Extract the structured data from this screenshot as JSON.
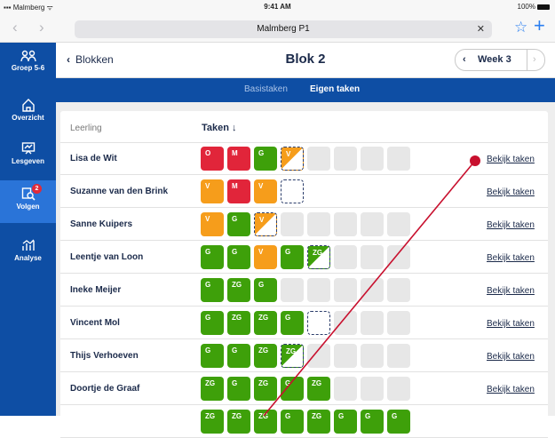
{
  "status": {
    "carrier": "Malmberg",
    "time": "9:41 AM",
    "battery": "100%"
  },
  "browser": {
    "url_title": "Malmberg P1",
    "back_icon": "chevron-left-icon",
    "forward_icon": "chevron-right-icon",
    "clear_icon": "close-icon",
    "bookmark_icon": "star-icon",
    "new_tab_icon": "plus-icon"
  },
  "sidebar": {
    "items": [
      {
        "label": "Groep 5-6",
        "icon": "group-icon"
      },
      {
        "label": "Overzicht",
        "icon": "home-icon"
      },
      {
        "label": "Lesgeven",
        "icon": "presentation-icon"
      },
      {
        "label": "Volgen",
        "icon": "search-list-icon",
        "badge": "2"
      },
      {
        "label": "Analyse",
        "icon": "chart-icon"
      }
    ]
  },
  "topbar": {
    "back_label": "Blokken",
    "title": "Blok 2",
    "week_label": "Week 3"
  },
  "tabs": {
    "basis": "Basistaken",
    "eigen": "Eigen taken"
  },
  "table": {
    "col_student": "Leerling",
    "col_tasks": "Taken",
    "link_label": "Bekijk taken",
    "rows": [
      {
        "name": "Lisa de Wit",
        "tiles": [
          [
            "red",
            "O"
          ],
          [
            "red",
            "M"
          ],
          [
            "grn",
            "G"
          ],
          [
            "half-o",
            "V"
          ],
          [
            "empty",
            ""
          ],
          [
            "empty",
            ""
          ],
          [
            "empty",
            ""
          ],
          [
            "empty",
            ""
          ]
        ]
      },
      {
        "name": "Suzanne van den Brink",
        "tiles": [
          [
            "org",
            "V"
          ],
          [
            "red",
            "M"
          ],
          [
            "org",
            "V"
          ],
          [
            "dash",
            ""
          ]
        ]
      },
      {
        "name": "Sanne Kuipers",
        "tiles": [
          [
            "org",
            "V"
          ],
          [
            "grn",
            "G"
          ],
          [
            "half-o",
            "V"
          ],
          [
            "empty",
            ""
          ],
          [
            "empty",
            ""
          ],
          [
            "empty",
            ""
          ],
          [
            "empty",
            ""
          ],
          [
            "empty",
            ""
          ]
        ]
      },
      {
        "name": "Leentje van Loon",
        "tiles": [
          [
            "grn",
            "G"
          ],
          [
            "grn",
            "G"
          ],
          [
            "org",
            "V"
          ],
          [
            "grn",
            "G"
          ],
          [
            "half-g",
            "ZG"
          ],
          [
            "empty",
            ""
          ],
          [
            "empty",
            ""
          ],
          [
            "empty",
            ""
          ]
        ]
      },
      {
        "name": "Ineke Meijer",
        "tiles": [
          [
            "grn",
            "G"
          ],
          [
            "grn",
            "ZG"
          ],
          [
            "grn",
            "G"
          ],
          [
            "empty",
            ""
          ],
          [
            "empty",
            ""
          ],
          [
            "empty",
            ""
          ],
          [
            "empty",
            ""
          ],
          [
            "empty",
            ""
          ]
        ]
      },
      {
        "name": "Vincent Mol",
        "tiles": [
          [
            "grn",
            "G"
          ],
          [
            "grn",
            "ZG"
          ],
          [
            "grn",
            "ZG"
          ],
          [
            "grn",
            "G"
          ],
          [
            "dash",
            ""
          ],
          [
            "empty",
            ""
          ],
          [
            "empty",
            ""
          ],
          [
            "empty",
            ""
          ]
        ]
      },
      {
        "name": "Thijs Verhoeven",
        "tiles": [
          [
            "grn",
            "G"
          ],
          [
            "grn",
            "G"
          ],
          [
            "grn",
            "ZG"
          ],
          [
            "half-g",
            "ZG"
          ],
          [
            "empty",
            ""
          ],
          [
            "empty",
            ""
          ],
          [
            "empty",
            ""
          ],
          [
            "empty",
            ""
          ]
        ]
      },
      {
        "name": "Doortje de Graaf",
        "tiles": [
          [
            "grn",
            "ZG"
          ],
          [
            "grn",
            "G"
          ],
          [
            "grn",
            "ZG"
          ],
          [
            "grn",
            "G"
          ],
          [
            "grn",
            "ZG"
          ],
          [
            "empty",
            ""
          ],
          [
            "empty",
            ""
          ],
          [
            "empty",
            ""
          ]
        ]
      },
      {
        "name": "",
        "tiles": [
          [
            "grn",
            "ZG"
          ],
          [
            "grn",
            "ZG"
          ],
          [
            "grn",
            "ZG"
          ],
          [
            "grn",
            "G"
          ],
          [
            "grn",
            "ZG"
          ],
          [
            "grn",
            "G"
          ],
          [
            "grn",
            "G"
          ],
          [
            "grn",
            "G"
          ]
        ]
      }
    ]
  },
  "colors": {
    "primary_blue": "#0e4ea4",
    "active_blue": "#2a74d8",
    "red": "#e1253a",
    "orange": "#f69d1b",
    "green": "#3ea00a",
    "annotation": "#c8102e"
  }
}
